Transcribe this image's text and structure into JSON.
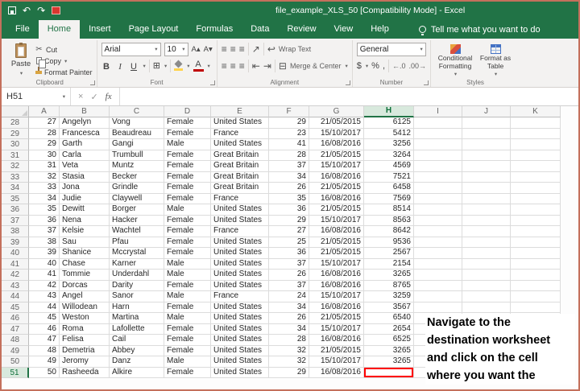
{
  "colors": {
    "excel_green": "#217346",
    "ribbon_background": "#f3f2f1",
    "annotation_red": "#ff0000",
    "selected_header_green": "#d8e9dd"
  },
  "titlebar": {
    "title": "file_example_XLS_50  [Compatibility Mode] - Excel"
  },
  "ribbon": {
    "tabs": [
      "File",
      "Home",
      "Insert",
      "Page Layout",
      "Formulas",
      "Data",
      "Review",
      "View",
      "Help"
    ],
    "active_tab": "Home",
    "tell_me": "Tell me what you want to do",
    "clipboard": {
      "label": "Clipboard",
      "paste": "Paste",
      "cut": "Cut",
      "copy": "Copy",
      "format_painter": "Format Painter"
    },
    "font": {
      "label": "Font",
      "family": "Arial",
      "size": "10"
    },
    "alignment": {
      "label": "Alignment",
      "wrap_text": "Wrap Text",
      "merge_center": "Merge & Center"
    },
    "number": {
      "label": "Number",
      "format": "General"
    },
    "styles": {
      "label": "Styles",
      "conditional_line1": "Conditional",
      "conditional_line2": "Formatting",
      "format_table_line1": "Format as",
      "format_table_line2": "Table"
    }
  },
  "formula_bar": {
    "name_box": "H51",
    "fx": "fx",
    "content": ""
  },
  "grid": {
    "columns": [
      "A",
      "B",
      "C",
      "D",
      "E",
      "F",
      "G",
      "H",
      "I",
      "J",
      "K"
    ],
    "selected_column": "H",
    "selected_row": 51,
    "rows": [
      {
        "n": 28,
        "cells": [
          "27",
          "Angelyn",
          "Vong",
          "Female",
          "United States",
          "29",
          "21/05/2015",
          "6125"
        ]
      },
      {
        "n": 29,
        "cells": [
          "28",
          "Francesca",
          "Beaudreau",
          "Female",
          "France",
          "23",
          "15/10/2017",
          "5412"
        ]
      },
      {
        "n": 30,
        "cells": [
          "29",
          "Garth",
          "Gangi",
          "Male",
          "United States",
          "41",
          "16/08/2016",
          "3256"
        ]
      },
      {
        "n": 31,
        "cells": [
          "30",
          "Carla",
          "Trumbull",
          "Female",
          "Great Britain",
          "28",
          "21/05/2015",
          "3264"
        ]
      },
      {
        "n": 32,
        "cells": [
          "31",
          "Veta",
          "Muntz",
          "Female",
          "Great Britain",
          "37",
          "15/10/2017",
          "4569"
        ]
      },
      {
        "n": 33,
        "cells": [
          "32",
          "Stasia",
          "Becker",
          "Female",
          "Great Britain",
          "34",
          "16/08/2016",
          "7521"
        ]
      },
      {
        "n": 34,
        "cells": [
          "33",
          "Jona",
          "Grindle",
          "Female",
          "Great Britain",
          "26",
          "21/05/2015",
          "6458"
        ]
      },
      {
        "n": 35,
        "cells": [
          "34",
          "Judie",
          "Claywell",
          "Female",
          "France",
          "35",
          "16/08/2016",
          "7569"
        ]
      },
      {
        "n": 36,
        "cells": [
          "35",
          "Dewitt",
          "Borger",
          "Male",
          "United States",
          "36",
          "21/05/2015",
          "8514"
        ]
      },
      {
        "n": 37,
        "cells": [
          "36",
          "Nena",
          "Hacker",
          "Female",
          "United States",
          "29",
          "15/10/2017",
          "8563"
        ]
      },
      {
        "n": 38,
        "cells": [
          "37",
          "Kelsie",
          "Wachtel",
          "Female",
          "France",
          "27",
          "16/08/2016",
          "8642"
        ]
      },
      {
        "n": 39,
        "cells": [
          "38",
          "Sau",
          "Pfau",
          "Female",
          "United States",
          "25",
          "21/05/2015",
          "9536"
        ]
      },
      {
        "n": 40,
        "cells": [
          "39",
          "Shanice",
          "Mccrystal",
          "Female",
          "United States",
          "36",
          "21/05/2015",
          "2567"
        ]
      },
      {
        "n": 41,
        "cells": [
          "40",
          "Chase",
          "Karner",
          "Male",
          "United States",
          "37",
          "15/10/2017",
          "2154"
        ]
      },
      {
        "n": 42,
        "cells": [
          "41",
          "Tommie",
          "Underdahl",
          "Male",
          "United States",
          "26",
          "16/08/2016",
          "3265"
        ]
      },
      {
        "n": 43,
        "cells": [
          "42",
          "Dorcas",
          "Darity",
          "Female",
          "United States",
          "37",
          "16/08/2016",
          "8765"
        ]
      },
      {
        "n": 44,
        "cells": [
          "43",
          "Angel",
          "Sanor",
          "Male",
          "France",
          "24",
          "15/10/2017",
          "3259"
        ]
      },
      {
        "n": 45,
        "cells": [
          "44",
          "Willodean",
          "Harn",
          "Female",
          "United States",
          "34",
          "16/08/2016",
          "3567"
        ]
      },
      {
        "n": 46,
        "cells": [
          "45",
          "Weston",
          "Martina",
          "Male",
          "United States",
          "26",
          "21/05/2015",
          "6540"
        ]
      },
      {
        "n": 47,
        "cells": [
          "46",
          "Roma",
          "Lafollette",
          "Female",
          "United States",
          "34",
          "15/10/2017",
          "2654"
        ]
      },
      {
        "n": 48,
        "cells": [
          "47",
          "Felisa",
          "Cail",
          "Female",
          "United States",
          "28",
          "16/08/2016",
          "6525"
        ]
      },
      {
        "n": 49,
        "cells": [
          "48",
          "Demetria",
          "Abbey",
          "Female",
          "United States",
          "32",
          "21/05/2015",
          "3265"
        ]
      },
      {
        "n": 50,
        "cells": [
          "49",
          "Jeromy",
          "Danz",
          "Male",
          "United States",
          "32",
          "15/10/2017",
          "3265"
        ]
      },
      {
        "n": 51,
        "cells": [
          "50",
          "Rasheeda",
          "Alkire",
          "Female",
          "United States",
          "29",
          "16/08/2016",
          ""
        ]
      }
    ]
  },
  "annotation": {
    "lines": [
      "Navigate to the",
      "destination worksheet",
      "and click on the cell",
      "where you want the"
    ]
  }
}
